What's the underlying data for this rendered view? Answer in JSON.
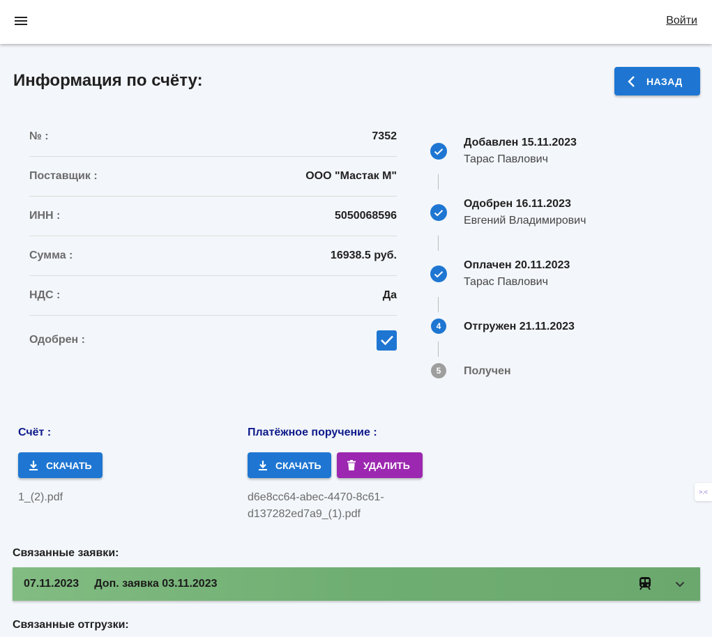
{
  "header": {
    "login_label": "Войти"
  },
  "page": {
    "title": "Информация по счёту:",
    "back_label": "НАЗАД"
  },
  "info": {
    "rows": [
      {
        "key": "№ :",
        "value": "7352"
      },
      {
        "key": "Поставщик :",
        "value": "ООО \"Мастак М\""
      },
      {
        "key": "ИНН :",
        "value": "5050068596"
      },
      {
        "key": "Сумма :",
        "value": "16938.5 руб."
      },
      {
        "key": "НДС :",
        "value": "Да"
      }
    ],
    "approved_label": "Одобрен :",
    "approved_checked": true
  },
  "steps": [
    {
      "title": "Добавлен 15.11.2023",
      "subtitle": "Тарас Павлович",
      "state": "done"
    },
    {
      "title": "Одобрен 16.11.2023",
      "subtitle": "Евгений Владимирович",
      "state": "done"
    },
    {
      "title": "Оплачен 20.11.2023",
      "subtitle": "Тарас Павлович",
      "state": "done"
    },
    {
      "number": "4",
      "title": "Отгружен 21.11.2023",
      "state": "active"
    },
    {
      "number": "5",
      "title": "Получен",
      "state": "pending"
    }
  ],
  "files": {
    "invoice": {
      "label": "Счёт :",
      "download_label": "СКАЧАТЬ",
      "filename": "1_(2).pdf"
    },
    "payment": {
      "label": "Платёжное поручение :",
      "download_label": "СКАЧАТЬ",
      "delete_label": "УДАЛИТЬ",
      "filename_line1": "d6e8cc64-abec-4470-8c61-",
      "filename_line2": "d137282ed7a9_(1).pdf"
    }
  },
  "related_requests": {
    "label": "Связанные заявки:",
    "items": [
      {
        "date": "07.11.2023",
        "title": "Доп. заявка 03.11.2023",
        "icon": "train-icon"
      }
    ]
  },
  "related_shipments": {
    "label": "Связанные отгрузки:"
  },
  "side_tab": {
    "text": ">.<"
  },
  "colors": {
    "primary": "#1e76d2",
    "danger": "#9c27b0",
    "request_bg": "#6fae72",
    "file_label": "#0d1a8a",
    "background": "#f3f6fa"
  }
}
